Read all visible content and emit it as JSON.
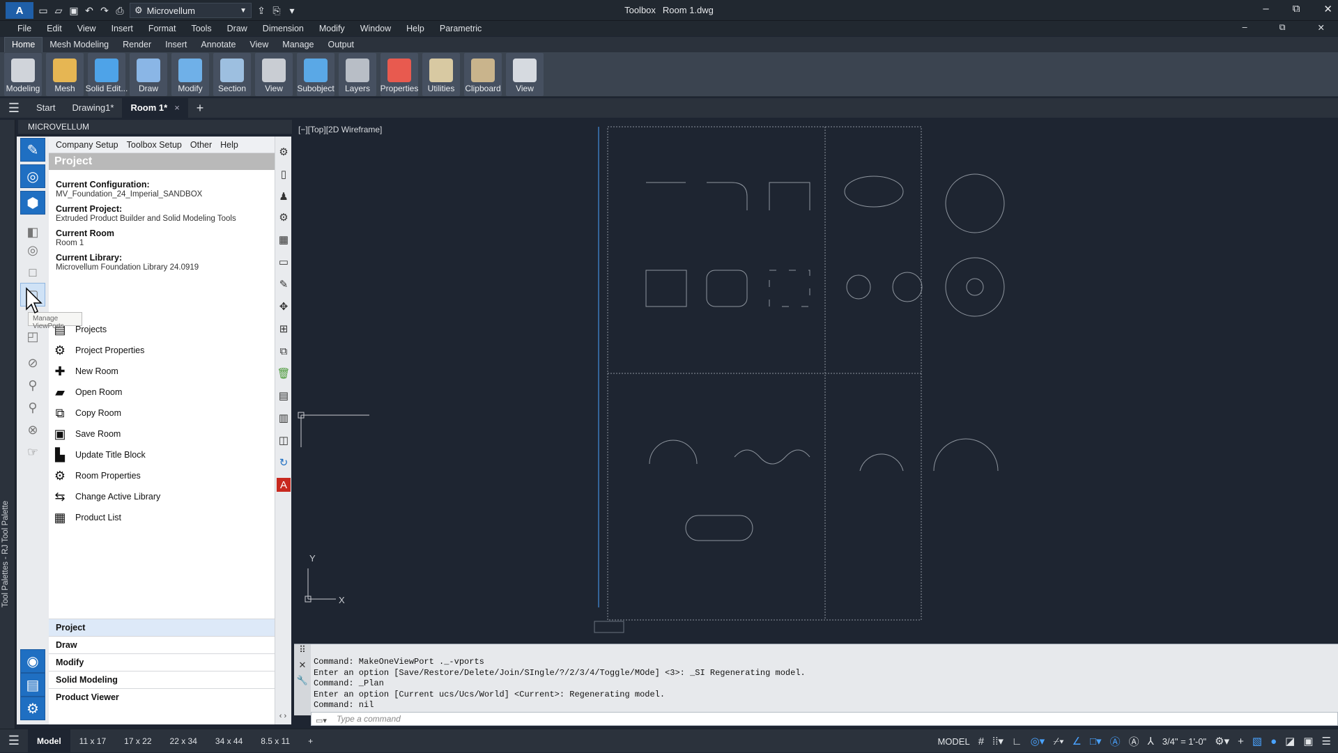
{
  "app": {
    "title": "Toolbox",
    "file": "Room 1.dwg",
    "workspace": "Microvellum"
  },
  "window_controls": {
    "minimize": "–",
    "restore": "⧉",
    "close": "✕"
  },
  "menubar": [
    "File",
    "Edit",
    "View",
    "Insert",
    "Format",
    "Tools",
    "Draw",
    "Dimension",
    "Modify",
    "Window",
    "Help",
    "Parametric"
  ],
  "ribbon_tabs": [
    "Home",
    "Mesh Modeling",
    "Render",
    "Insert",
    "Annotate",
    "View",
    "Manage",
    "Output"
  ],
  "ribbon_buttons": [
    {
      "label": "Modeling",
      "color": "#d0d4da"
    },
    {
      "label": "Mesh",
      "color": "#e6b653"
    },
    {
      "label": "Solid Edit...",
      "color": "#4ea3e8"
    },
    {
      "label": "Draw",
      "color": "#8ab6e6"
    },
    {
      "label": "Modify",
      "color": "#6fb0e8"
    },
    {
      "label": "Section",
      "color": "#9dbfe0"
    },
    {
      "label": "View",
      "color": "#c9cdd3"
    },
    {
      "label": "Subobject",
      "color": "#5aa8e6"
    },
    {
      "label": "Layers",
      "color": "#b8bec6"
    },
    {
      "label": "Properties",
      "color": "#e85a4f"
    },
    {
      "label": "Utilities",
      "color": "#d8c9a2"
    },
    {
      "label": "Clipboard",
      "color": "#c9b48c"
    },
    {
      "label": "View",
      "color": "#d6dae0"
    }
  ],
  "doc_tabs": [
    {
      "label": "Start"
    },
    {
      "label": "Drawing1*"
    },
    {
      "label": "Room 1*",
      "active": true,
      "close": "×"
    }
  ],
  "palette": {
    "vertical_label": "Tool Palettes - RJ Tool Palette",
    "header": "MICROVELLUM",
    "tooltip": "Manage ViewPorts"
  },
  "panel": {
    "menu": [
      "Company Setup",
      "Toolbox Setup",
      "Other",
      "Help"
    ],
    "section_title": "Project",
    "info": [
      {
        "label": "Current Configuration:",
        "value": "MV_Foundation_24_Imperial_SANDBOX"
      },
      {
        "label": "Current Project:",
        "value": "Extruded Product Builder and Solid Modeling Tools"
      },
      {
        "label": "Current Room",
        "value": "Room 1"
      },
      {
        "label": "Current Library:",
        "value": "Microvellum Foundation Library 24.0919"
      }
    ],
    "commands": [
      {
        "label": "Projects",
        "icon": "projects-icon"
      },
      {
        "label": "Project Properties",
        "icon": "gear-icon"
      },
      {
        "label": "New Room",
        "icon": "plus-icon"
      },
      {
        "label": "Open Room",
        "icon": "folder-open-icon"
      },
      {
        "label": "Copy Room",
        "icon": "copy-icon"
      },
      {
        "label": "Save Room",
        "icon": "save-icon"
      },
      {
        "label": "Update Title Block",
        "icon": "title-block-icon"
      },
      {
        "label": "Room Properties",
        "icon": "gear-icon"
      },
      {
        "label": "Change Active Library",
        "icon": "swap-arrows-icon"
      },
      {
        "label": "Product List",
        "icon": "grid-list-icon"
      }
    ],
    "sections": [
      "Project",
      "Draw",
      "Modify",
      "Solid Modeling",
      "Product Viewer"
    ]
  },
  "viewport": {
    "label": "[−][Top][2D Wireframe]",
    "ucs_x": "X",
    "ucs_y": "Y"
  },
  "command_window": {
    "lines": [
      "Command: MakeOneViewPort ._-vports",
      "Enter an option [Save/Restore/Delete/Join/SIngle/?/2/3/4/Toggle/MOde] <3>: _SI Regenerating model.",
      "Command: _Plan",
      "Enter an option [Current ucs/Ucs/World] <Current>: Regenerating model.",
      "Command: nil"
    ],
    "placeholder": "Type a command"
  },
  "status": {
    "layouts": [
      "Model",
      "11 x 17",
      "17 x 22",
      "22 x 34",
      "34 x 44",
      "8.5 x 11"
    ],
    "space": "MODEL",
    "scale": "3/4\" = 1'-0\""
  }
}
